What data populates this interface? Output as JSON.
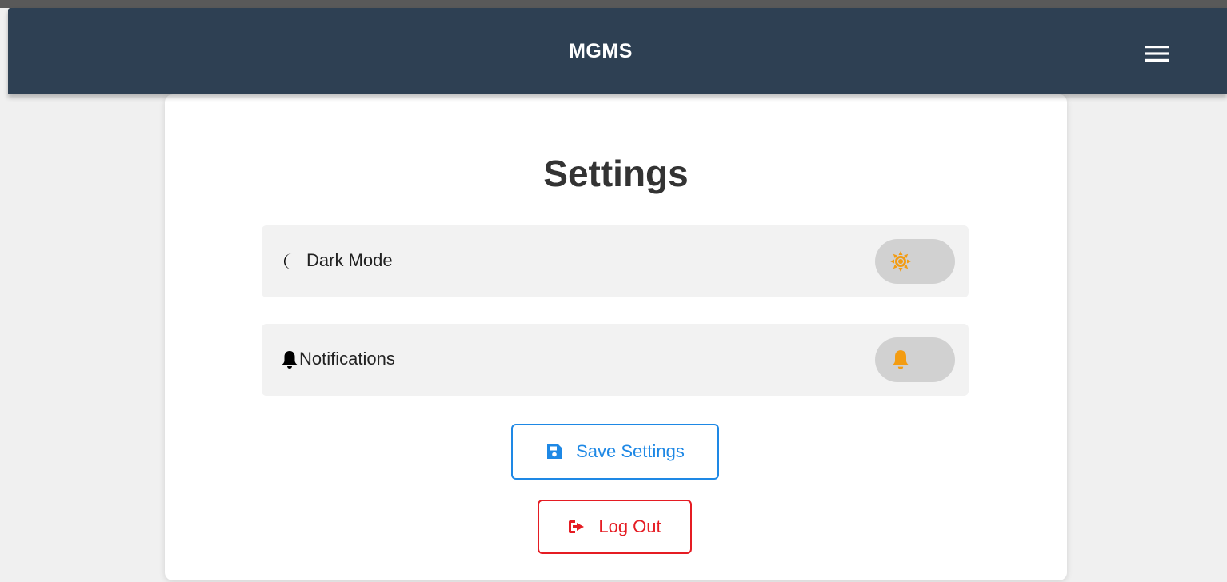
{
  "app": {
    "brand": "MGMS"
  },
  "page": {
    "title": "Settings"
  },
  "settings": [
    {
      "id": "dark-mode",
      "label": "Dark Mode",
      "icon": "moon-icon",
      "toggle_icon": "sun-icon",
      "enabled": false
    },
    {
      "id": "notifications",
      "label": "Notifications",
      "icon": "bell-icon",
      "toggle_icon": "bell-icon",
      "enabled": false
    }
  ],
  "actions": {
    "save_label": "Save Settings",
    "save_icon": "floppy-disk-icon",
    "logout_label": "Log Out",
    "logout_icon": "sign-out-icon"
  },
  "colors": {
    "navbar": "#2e4053",
    "save": "#1e88e5",
    "logout": "#e51c23",
    "toggle_icon": "#f39c12"
  }
}
